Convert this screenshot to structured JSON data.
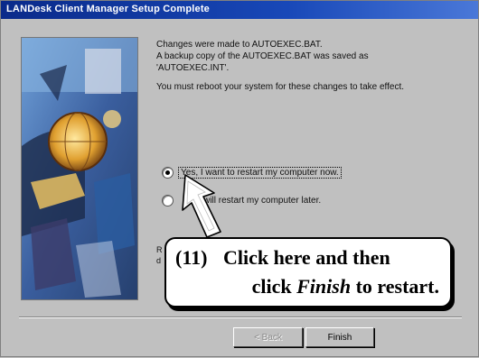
{
  "window": {
    "title": "LANDesk Client Manager Setup Complete"
  },
  "message": {
    "line1": "Changes were made to AUTOEXEC.BAT.",
    "line2": "A backup copy of the AUTOEXEC.BAT was saved as",
    "line3": "'AUTOEXEC.INT'.",
    "line4": "You must reboot your system for these changes to take effect."
  },
  "options": {
    "restart_now": {
      "label": "Yes, I want to restart my computer now.",
      "checked": true
    },
    "restart_later": {
      "label": "No, I will restart my computer later.",
      "visible_label": ", I will restart my computer later.",
      "checked": false
    }
  },
  "hidden_text": {
    "a": "R",
    "b": "d"
  },
  "callout": {
    "number": "(11)",
    "line1_text": "Click here and then",
    "line2_prefix": "click ",
    "line2_italic": "Finish",
    "line2_suffix": " to restart."
  },
  "buttons": {
    "back": "< Back",
    "finish": "Finish"
  },
  "icons": {
    "pointer": "arrow-pointer-icon",
    "sidebar": "setup-illustration"
  }
}
